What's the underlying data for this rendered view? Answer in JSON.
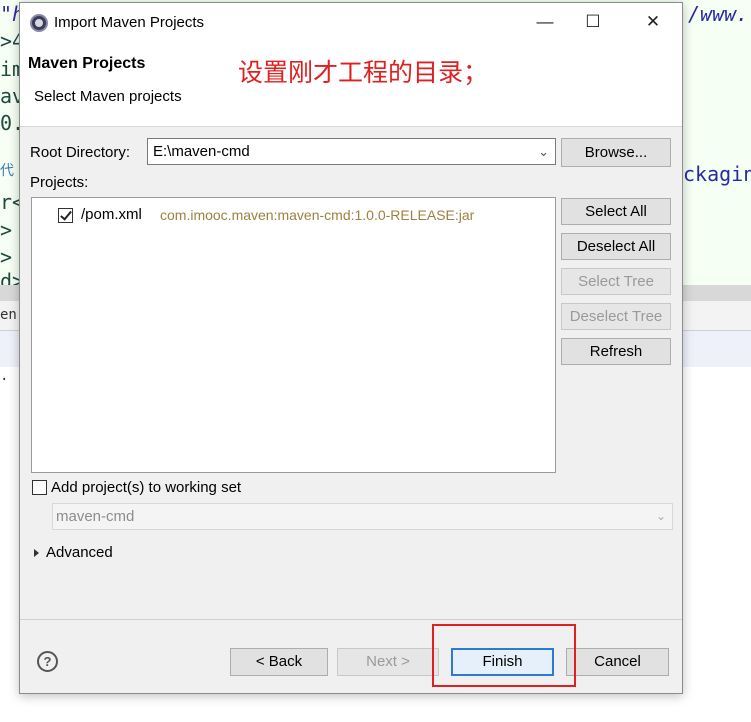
{
  "background": {
    "code_lines": [
      ">4",
      "im",
      "av",
      "0.",
      "代",
      "r<",
      ">",
      ">",
      "d>"
    ],
    "top_fragment": "\"h",
    "top_right_fragment": "/www.",
    "right_fragment": "ckagin",
    "strip_fragment": "en",
    "strip2_fragment": "."
  },
  "dialog": {
    "title": "Import Maven Projects",
    "window_buttons": {
      "minimize": "—",
      "maximize": "☐",
      "close": "✕"
    },
    "header": {
      "title": "Maven Projects",
      "subtitle": "Select Maven projects",
      "annotation": "设置刚才工程的目录；"
    },
    "root_directory": {
      "label": "Root Directory:",
      "value": "E:\\maven-cmd",
      "browse_label": "Browse..."
    },
    "projects": {
      "label": "Projects:",
      "items": [
        {
          "name": "/pom.xml",
          "gav": "com.imooc.maven:maven-cmd:1.0.0-RELEASE:jar",
          "checked": true
        }
      ]
    },
    "side_buttons": {
      "select_all": "Select All",
      "deselect_all": "Deselect All",
      "select_tree": "Select Tree",
      "deselect_tree": "Deselect Tree",
      "refresh": "Refresh"
    },
    "working_set": {
      "label": "Add project(s) to working set",
      "checked": false,
      "value": "maven-cmd"
    },
    "advanced_label": "Advanced",
    "footer": {
      "help": "?",
      "back": "< Back",
      "next": "Next >",
      "finish": "Finish",
      "cancel": "Cancel"
    }
  },
  "colors": {
    "annotation": "#e02020",
    "default_button_border": "#2e7ad1",
    "gav_text": "#a08040"
  }
}
